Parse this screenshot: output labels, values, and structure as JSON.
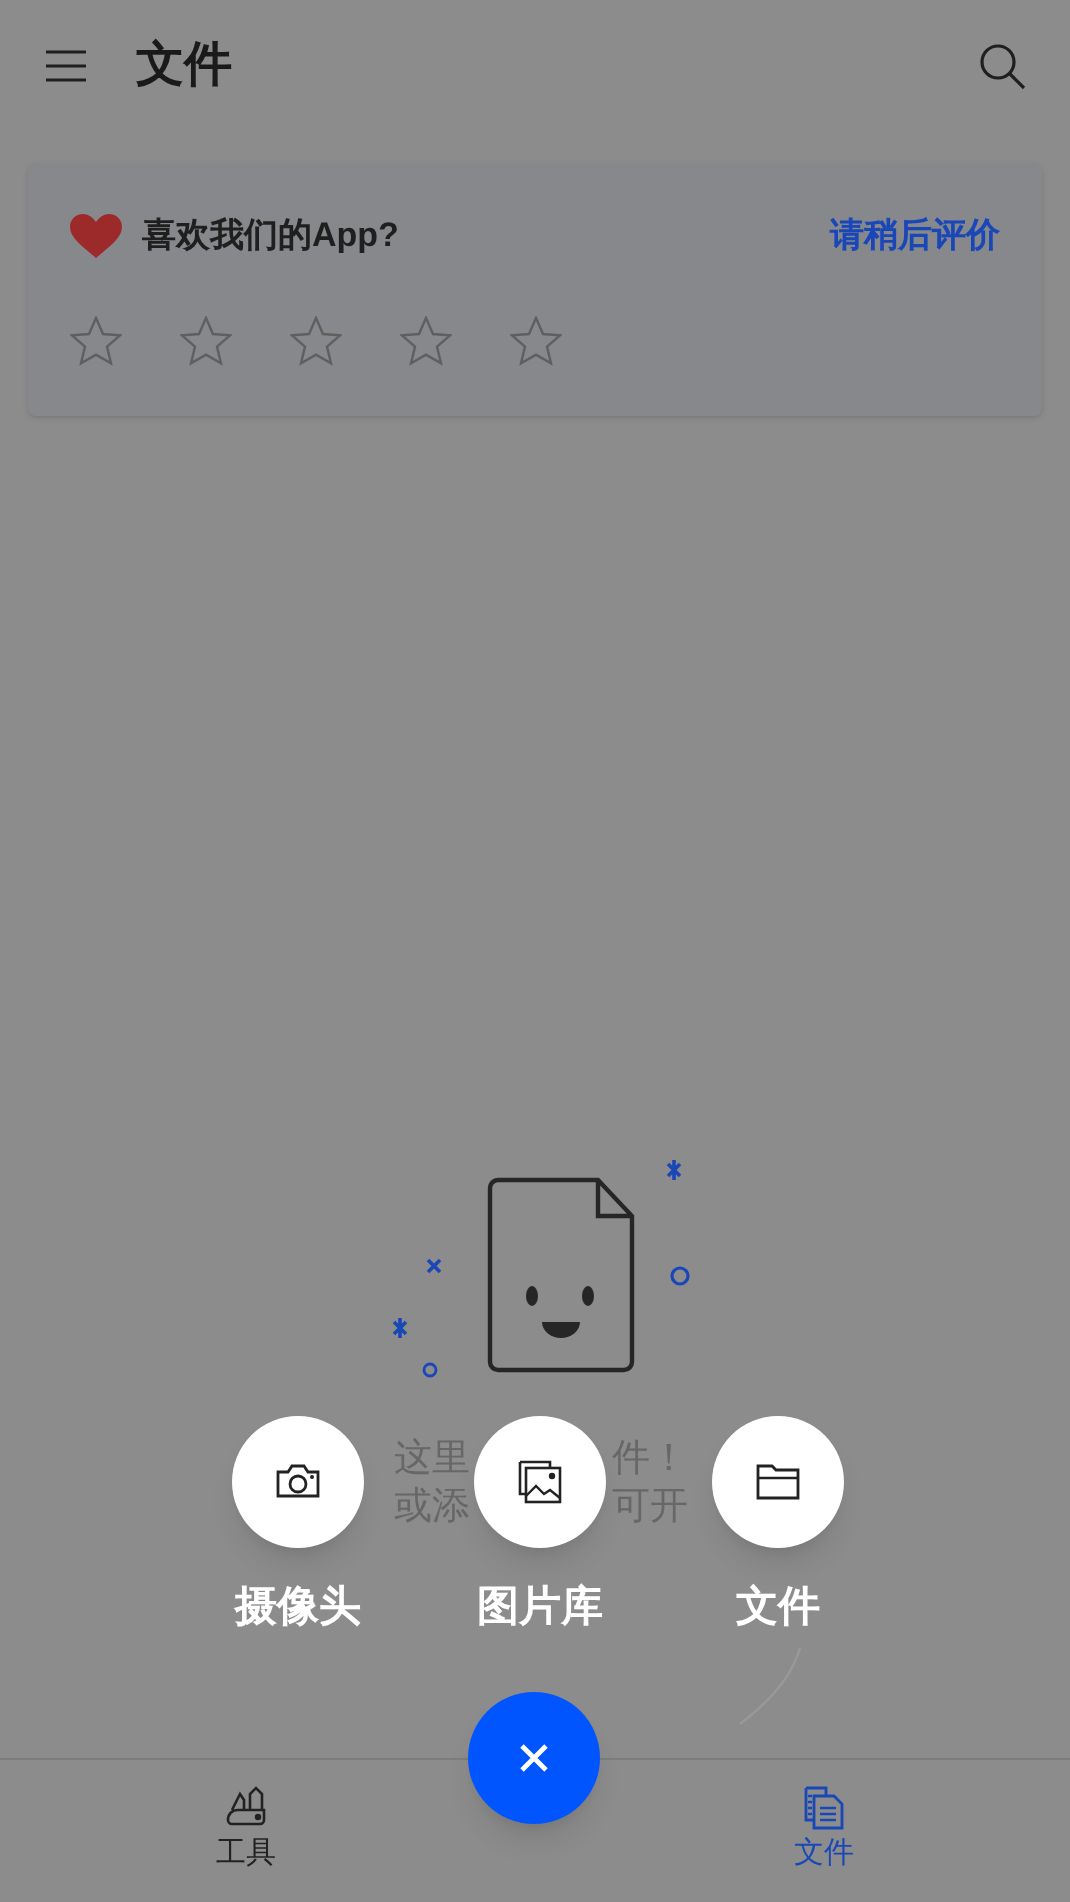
{
  "header": {
    "title": "文件"
  },
  "rating_card": {
    "question": "喜欢我们的App?",
    "later_link": "请稍后评价",
    "stars": 0
  },
  "empty_state": {
    "lines": [
      {
        "left": "这里",
        "right": "件！"
      },
      {
        "left": "或添",
        "right": "可开"
      }
    ]
  },
  "speed_dial": [
    {
      "label": "摄像头",
      "kind": "camera"
    },
    {
      "label": "图片库",
      "kind": "gallery"
    },
    {
      "label": "文件",
      "kind": "folder"
    }
  ],
  "bottom_nav": [
    {
      "label": "工具",
      "kind": "tools",
      "selected": false
    },
    {
      "label": "文件",
      "kind": "files",
      "selected": true
    }
  ]
}
